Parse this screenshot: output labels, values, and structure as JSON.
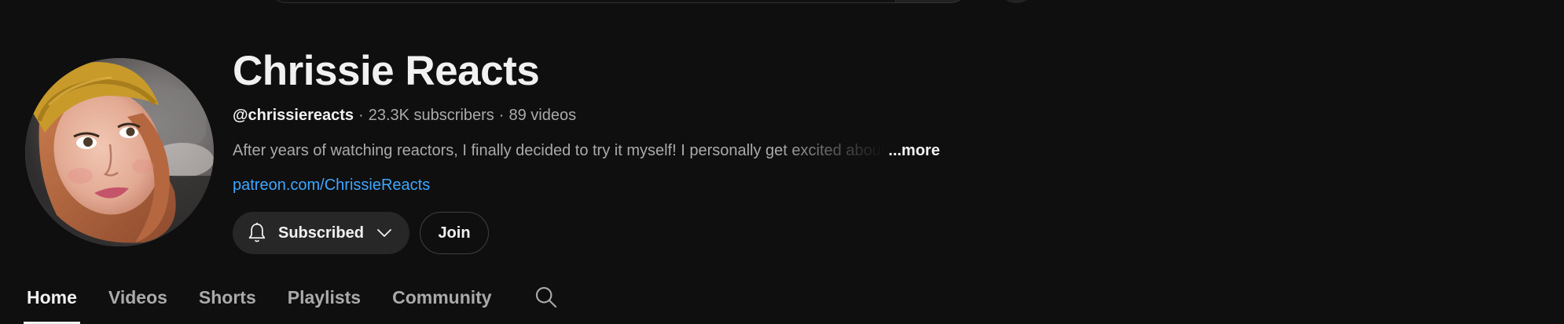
{
  "channel": {
    "title": "Chrissie Reacts",
    "handle": "@chrissiereacts",
    "separator": "·",
    "subscribers": "23.3K subscribers",
    "videos": "89 videos",
    "description": "After years of watching reactors, I finally decided to try it myself! I personally get excited about",
    "more_label": "...more",
    "link": "patreon.com/ChrissieReacts",
    "avatar_icon": "avatar-photo"
  },
  "actions": {
    "subscribed_label": "Subscribed",
    "subscribed_icon": "bell-icon",
    "dropdown_icon": "chevron-down-icon",
    "join_label": "Join"
  },
  "tabs": [
    {
      "label": "Home",
      "active": true
    },
    {
      "label": "Videos",
      "active": false
    },
    {
      "label": "Shorts",
      "active": false
    },
    {
      "label": "Playlists",
      "active": false
    },
    {
      "label": "Community",
      "active": false
    }
  ],
  "tab_search_icon": "search-icon",
  "colors": {
    "background": "#0f0f0f",
    "text_primary": "#f1f1f1",
    "text_secondary": "#aaaaaa",
    "link": "#3ea6ff",
    "button_bg": "#272727"
  }
}
